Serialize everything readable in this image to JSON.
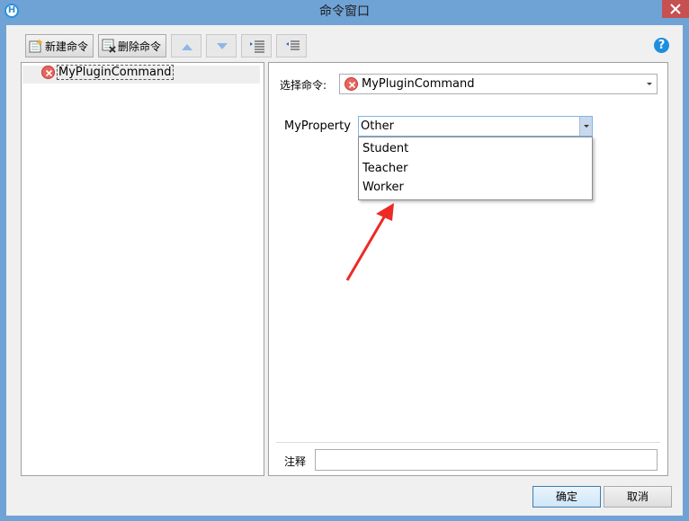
{
  "window": {
    "title": "命令窗口",
    "app_icon_letter": "H"
  },
  "toolbar": {
    "new_command": "新建命令",
    "delete_command": "删除命令",
    "help": "?"
  },
  "tree": {
    "items": [
      {
        "label": "MyPluginCommand",
        "icon": "error-circle-icon"
      }
    ]
  },
  "editor": {
    "select_command_label": "选择命令:",
    "selected_command": "MyPluginCommand",
    "property_label": "MyProperty",
    "property_value": "Other",
    "property_options": [
      "Student",
      "Teacher",
      "Worker"
    ],
    "note_label": "注释",
    "note_value": ""
  },
  "footer": {
    "ok": "确定",
    "cancel": "取消"
  },
  "colors": {
    "titlebar": "#6fa3d6",
    "close": "#c75050",
    "error_icon": "#e8655f",
    "annotation_arrow": "#ee2a24"
  }
}
